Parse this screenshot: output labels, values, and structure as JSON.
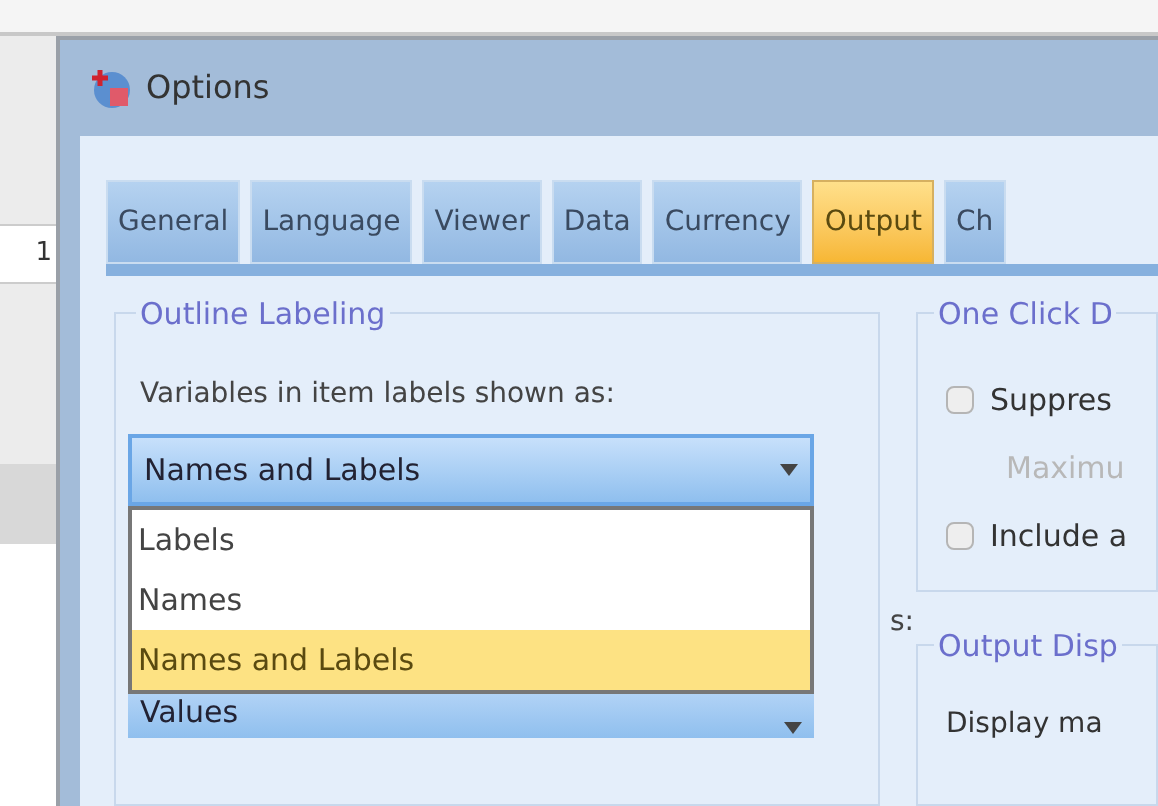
{
  "background_app": {
    "cell_text": "1"
  },
  "window": {
    "title": "Options"
  },
  "tabs": [
    {
      "label": "General",
      "selected": false
    },
    {
      "label": "Language",
      "selected": false
    },
    {
      "label": "Viewer",
      "selected": false
    },
    {
      "label": "Data",
      "selected": false
    },
    {
      "label": "Currency",
      "selected": false
    },
    {
      "label": "Output",
      "selected": true
    },
    {
      "label": "Ch",
      "selected": false
    }
  ],
  "outline_labeling": {
    "title": "Outline Labeling",
    "variables_label": "Variables in item labels shown as:",
    "variables_value": "Names and Labels",
    "dropdown_options": [
      {
        "label": "Labels",
        "selected": false
      },
      {
        "label": "Names",
        "selected": false
      },
      {
        "label": "Names and Labels",
        "selected": true
      }
    ],
    "hidden_label_end": "s:",
    "values_value": "Values"
  },
  "one_click": {
    "title": "One Click D",
    "items": [
      {
        "kind": "checkbox",
        "label": "Suppres",
        "checked": false,
        "disabled": false
      },
      {
        "kind": "field",
        "label": "Maximu",
        "disabled": true
      },
      {
        "kind": "checkbox",
        "label": "Include a",
        "checked": false,
        "disabled": false
      }
    ]
  },
  "output_display": {
    "title": "Output Disp",
    "label": "Display ma"
  }
}
